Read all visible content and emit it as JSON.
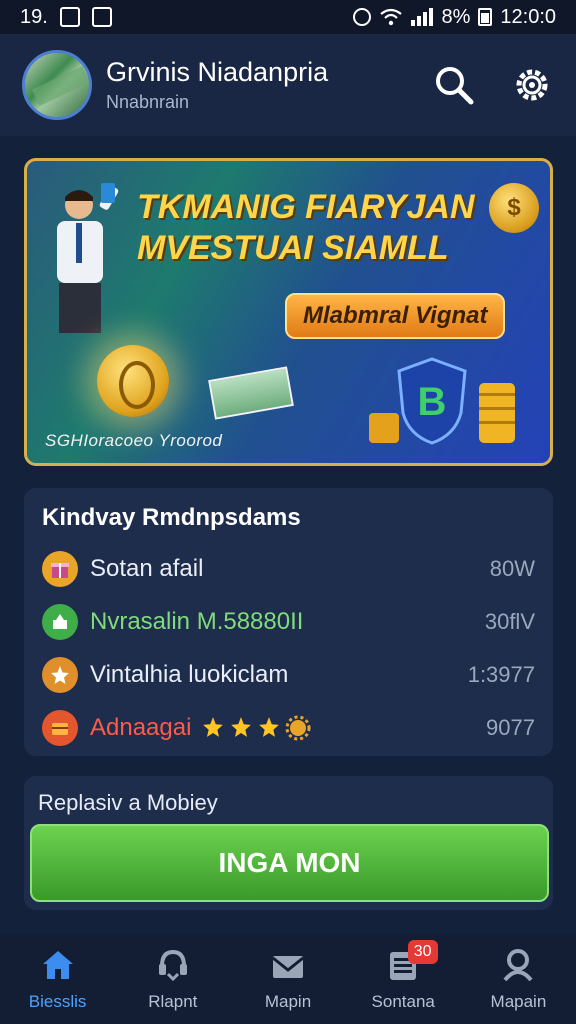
{
  "status_bar": {
    "time_left": "19.",
    "battery_percent": "8%",
    "clock": "12:0:0"
  },
  "header": {
    "title": "Grvinis Niadanpria",
    "subtitle": "Nnabnrain",
    "search_icon": "search-icon",
    "settings_icon": "gear-icon"
  },
  "banner": {
    "headline_line1": "TKMANIG FIARYJAN",
    "headline_line2": "MVESTUAI SIAMLL",
    "coin_symbol": "$",
    "cta_label": "Mlabmral Vignat",
    "shield_symbol": "B",
    "caption": "SGHIoracoeo Yroorod"
  },
  "list_card": {
    "title": "Kindvay Rmdnpsdams",
    "rows": [
      {
        "label": "Sotan afail",
        "value": "80W",
        "icon": "gift-icon",
        "color": "#e9a52a",
        "label_color": "#e9eef8"
      },
      {
        "label": "Nvrasalin M.58880II",
        "value": "30flV",
        "icon": "store-icon",
        "color": "#3fae49",
        "label_color": "#7fdc7a"
      },
      {
        "label": "Vintalhia luokiclam",
        "value": "1:3977",
        "icon": "star-badge-icon",
        "color": "#e0902a",
        "label_color": "#e9eef8"
      },
      {
        "label": "Adnaagai",
        "value": "9077",
        "icon": "chest-icon",
        "color": "#e4572e",
        "label_color": "#ff5a4a"
      }
    ],
    "rating_stars": 3
  },
  "action_card": {
    "label": "Replasiv a Mobiey",
    "button_label": "INGA MON",
    "button_color": "#4cb83a"
  },
  "bottom_nav": {
    "items": [
      {
        "label": "Biesslis",
        "icon": "home-icon",
        "active": true
      },
      {
        "label": "Rlapnt",
        "icon": "support-icon",
        "active": false
      },
      {
        "label": "Mapin",
        "icon": "mail-icon",
        "active": false
      },
      {
        "label": "Sontana",
        "icon": "list-icon",
        "active": false,
        "badge": "30"
      },
      {
        "label": "Mapain",
        "icon": "profile-icon",
        "active": false
      }
    ]
  },
  "colors": {
    "background": "#14213a",
    "card": "#1f2d4d",
    "accent_blue": "#4ba3ff",
    "banner_border": "#d8b04a"
  }
}
